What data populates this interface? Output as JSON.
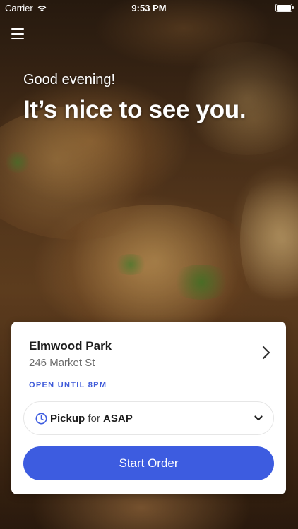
{
  "status_bar": {
    "carrier": "Carrier",
    "time": "9:53 PM",
    "wifi_icon": "wifi-icon",
    "battery_icon": "battery-icon"
  },
  "header": {
    "menu_icon": "hamburger-menu-icon",
    "greeting": "Good evening!",
    "headline": "It’s nice to see you."
  },
  "location_card": {
    "name": "Elmwood Park",
    "address": "246 Market St",
    "open_status": "OPEN UNTIL 8PM",
    "chevron_icon": "chevron-right-icon",
    "order_type": {
      "icon": "clock-icon",
      "mode": "Pickup",
      "connector": "for",
      "time": "ASAP",
      "dropdown_icon": "chevron-down-icon"
    },
    "cta_label": "Start Order"
  },
  "colors": {
    "accent": "#3d5ce0",
    "open_status": "#3f5bd9",
    "card_bg": "#ffffff"
  }
}
